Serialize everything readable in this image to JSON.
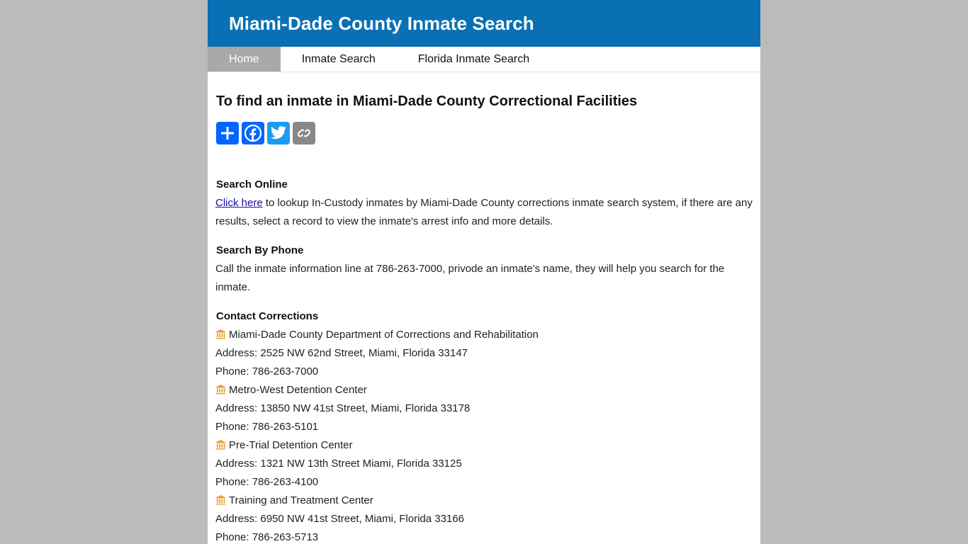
{
  "header": {
    "title": "Miami-Dade County Inmate Search"
  },
  "nav": {
    "items": [
      {
        "label": "Home"
      },
      {
        "label": "Inmate Search"
      },
      {
        "label": "Florida Inmate Search"
      }
    ]
  },
  "main": {
    "title": "To find an inmate in Miami-Dade County Correctional Facilities",
    "share_icons": [
      "add-icon",
      "facebook-icon",
      "twitter-icon",
      "copy-link-icon"
    ],
    "search_online": {
      "title": "Search Online",
      "link": "Click here",
      "text": " to lookup In-Custody inmates by Miami-Dade County corrections inmate search system, if there are any results, select a record to view the inmate's arrest info and more details."
    },
    "search_phone": {
      "title": "Search By Phone",
      "text": "Call the inmate information line at 786-263-7000, privode an inmate's name, they will help you search for the inmate."
    },
    "contact": {
      "title": "Contact Corrections",
      "facility_icon": "building-icon",
      "facilities": [
        {
          "name": "Miami-Dade County Department of Corrections and Rehabilitation",
          "address": "Address: 2525 NW 62nd Street, Miami, Florida 33147",
          "phone": "Phone: 786-263-7000"
        },
        {
          "name": "Metro-West Detention Center",
          "address": "Address: 13850 NW 41st Street, Miami, Florida 33178",
          "phone": "Phone: 786-263-5101"
        },
        {
          "name": "Pre-Trial Detention Center",
          "address": "Address: 1321 NW 13th Street Miami, Florida 33125",
          "phone": "Phone: 786-263-4100"
        },
        {
          "name": "Training and Treatment Center",
          "address": "Address: 6950 NW 41st Street, Miami, Florida 33166",
          "phone": "Phone: 786-263-5713"
        }
      ]
    }
  },
  "colors": {
    "header_bg": "#0970b4",
    "nav_active_bg": "#a9a9a9",
    "page_bg": "#bbbbbb",
    "icon_orange": "#e8a33a"
  }
}
